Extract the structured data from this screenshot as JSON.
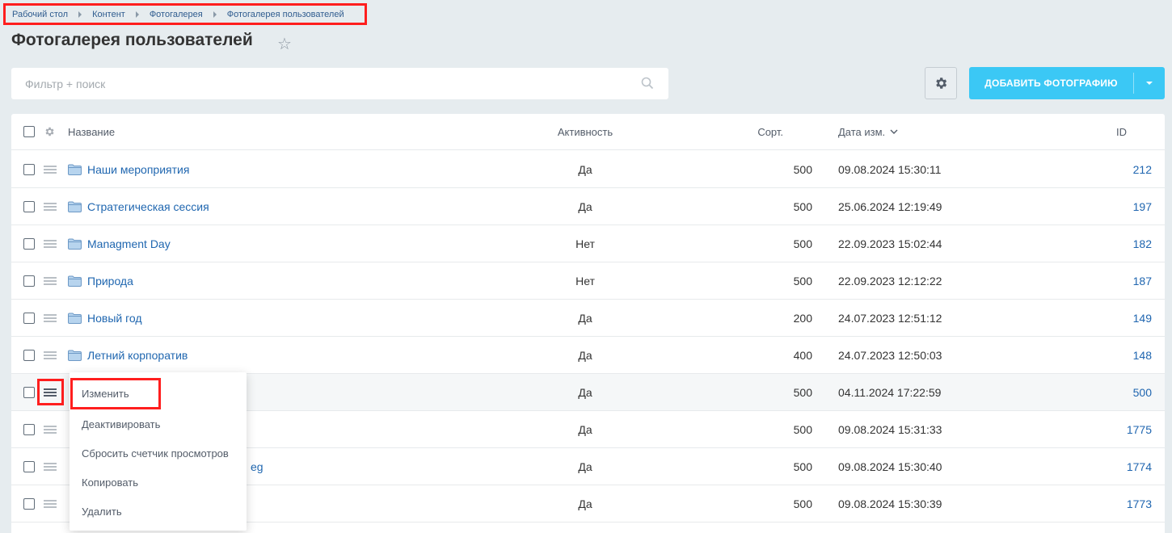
{
  "breadcrumb": [
    "Рабочий стол",
    "Контент",
    "Фотогалерея",
    "Фотогалерея пользователей"
  ],
  "page_title": "Фотогалерея пользователей",
  "filter": {
    "placeholder": "Фильтр + поиск"
  },
  "toolbar": {
    "add_label": "ДОБАВИТЬ ФОТОГРАФИЮ"
  },
  "columns": {
    "name": "Название",
    "active": "Активность",
    "sort": "Сорт.",
    "date": "Дата изм.",
    "id": "ID"
  },
  "rows": [
    {
      "name": "Наши мероприятия",
      "active": "Да",
      "sort": "500",
      "date": "09.08.2024 15:30:11",
      "id": "212"
    },
    {
      "name": "Стратегическая сессия",
      "active": "Да",
      "sort": "500",
      "date": "25.06.2024 12:19:49",
      "id": "197"
    },
    {
      "name": "Managment Day",
      "active": "Нет",
      "sort": "500",
      "date": "22.09.2023 15:02:44",
      "id": "182"
    },
    {
      "name": "Природа",
      "active": "Нет",
      "sort": "500",
      "date": "22.09.2023 12:12:22",
      "id": "187"
    },
    {
      "name": "Новый год",
      "active": "Да",
      "sort": "200",
      "date": "24.07.2023 12:51:12",
      "id": "149"
    },
    {
      "name": "Летний корпоратив",
      "active": "Да",
      "sort": "400",
      "date": "24.07.2023 12:50:03",
      "id": "148"
    },
    {
      "name": "",
      "active": "Да",
      "sort": "500",
      "date": "04.11.2024 17:22:59",
      "id": "500"
    },
    {
      "name": "",
      "active": "Да",
      "sort": "500",
      "date": "09.08.2024 15:31:33",
      "id": "1775"
    },
    {
      "name": "eg",
      "active": "Да",
      "sort": "500",
      "date": "09.08.2024 15:30:40",
      "id": "1774"
    },
    {
      "name": "",
      "active": "Да",
      "sort": "500",
      "date": "09.08.2024 15:30:39",
      "id": "1773"
    }
  ],
  "context_menu": [
    "Изменить",
    "Деактивировать",
    "Сбросить счетчик просмотров",
    "Копировать",
    "Удалить"
  ],
  "colors": {
    "accent": "#3bc8f5",
    "link": "#2067b0",
    "highlight": "#ff1e1e"
  },
  "icons": [
    "star-icon",
    "search-icon",
    "gear-icon",
    "folder-icon",
    "burger-icon",
    "chevron-down-icon"
  ]
}
